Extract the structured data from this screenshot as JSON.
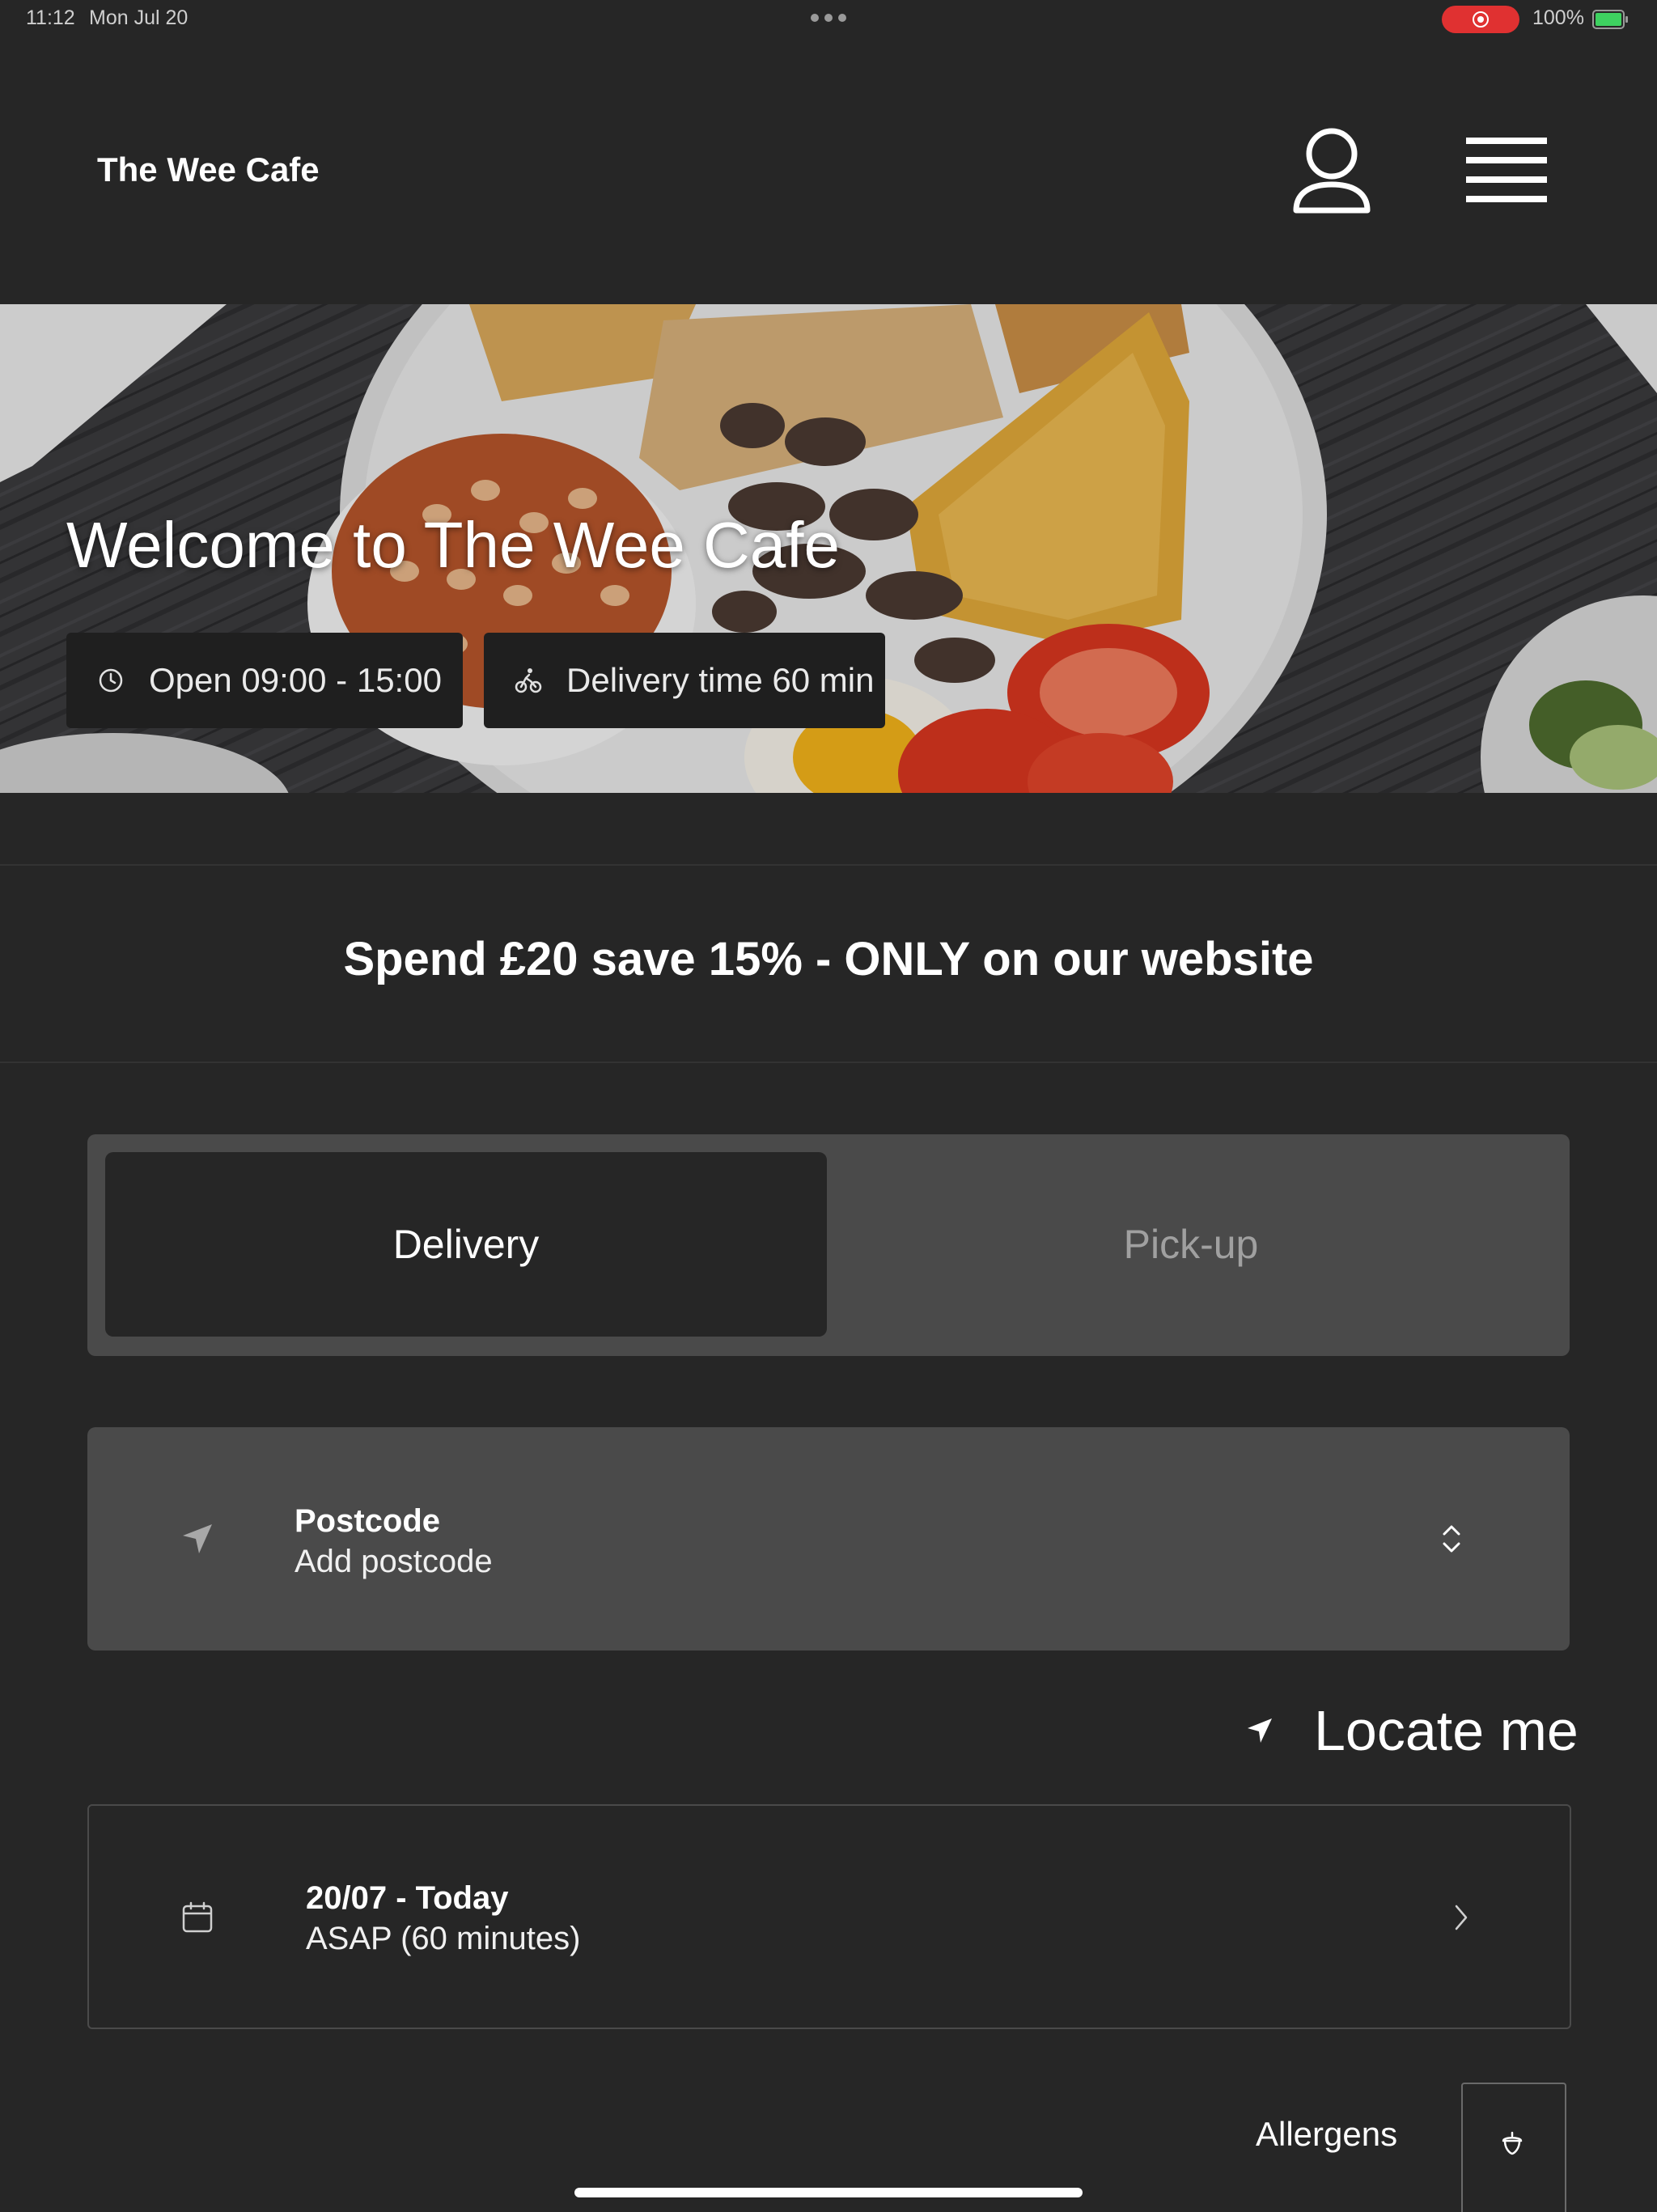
{
  "status_bar": {
    "time": "11:12",
    "date": "Mon Jul 20",
    "battery": "100%"
  },
  "header": {
    "brand": "The Wee Cafe",
    "profile_icon": "person-icon",
    "menu_icon": "hamburger-menu-icon"
  },
  "hero": {
    "title": "Welcome to The Wee Cafe",
    "open_hours": "Open 09:00 - 15:00",
    "delivery_time": "Delivery time 60 min",
    "open_icon": "clock-icon",
    "delivery_icon": "bicycle-icon"
  },
  "promo": {
    "text": "Spend £20 save 15% - ONLY on our website"
  },
  "order_mode": {
    "tabs": [
      "Delivery",
      "Pick-up"
    ],
    "selected": "Delivery"
  },
  "postcode": {
    "label": "Postcode",
    "value": "Add postcode"
  },
  "locate": {
    "label": "Locate me"
  },
  "schedule": {
    "date": "20/07 - Today",
    "time": "ASAP (60 minutes)"
  },
  "allergens": {
    "label": "Allergens",
    "icon": "acorn-icon"
  },
  "colors": {
    "background": "#262626",
    "panel": "#4a4a4a",
    "chip": "#1f1f1f",
    "accent_text": "#ffffff",
    "muted_text": "#a0a0a0",
    "record_indicator": "#e03131",
    "battery": "#3ed160"
  }
}
